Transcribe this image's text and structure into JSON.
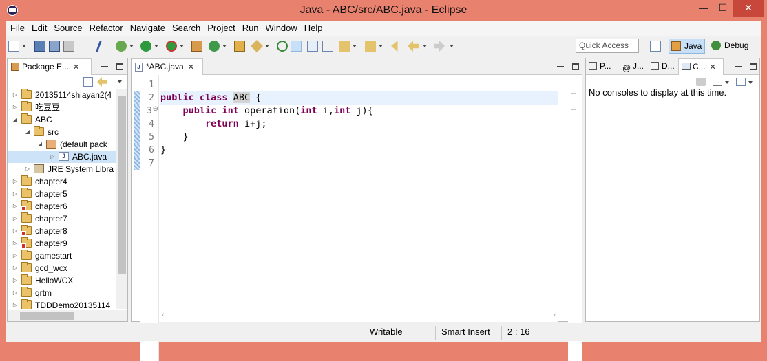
{
  "window": {
    "title": "Java - ABC/src/ABC.java - Eclipse",
    "controls": {
      "minimize": "—",
      "maximize": "☐",
      "close": "✕"
    }
  },
  "menu": [
    "File",
    "Edit",
    "Source",
    "Refactor",
    "Navigate",
    "Search",
    "Project",
    "Run",
    "Window",
    "Help"
  ],
  "toolbar": {
    "quick_access_placeholder": "Quick Access",
    "perspectives": [
      "Java",
      "Debug"
    ],
    "icons": [
      "new-icon",
      "save-icon",
      "save-all-icon",
      "print-icon",
      "toggle-mark-icon",
      "debug-icon",
      "run-icon",
      "external-tools-icon",
      "new-package-icon",
      "new-class-icon",
      "open-type-icon",
      "search-icon",
      "mark-occurrences-icon",
      "block-selection-icon",
      "show-whitespace-icon",
      "next-annotation-icon",
      "prev-annotation-icon",
      "last-edit-icon",
      "back-icon",
      "forward-icon"
    ]
  },
  "package_explorer": {
    "tab_label": "Package E...",
    "tree": [
      {
        "label": "20135114shiayan2(4",
        "depth": 0,
        "expanded": false,
        "kind": "project",
        "error": false
      },
      {
        "label": "吃豆豆",
        "depth": 0,
        "expanded": false,
        "kind": "project",
        "error": false
      },
      {
        "label": "ABC",
        "depth": 0,
        "expanded": true,
        "kind": "project",
        "error": false
      },
      {
        "label": "src",
        "depth": 1,
        "expanded": true,
        "kind": "src",
        "error": false
      },
      {
        "label": "(default pack",
        "depth": 2,
        "expanded": true,
        "kind": "package",
        "error": false
      },
      {
        "label": "ABC.java",
        "depth": 3,
        "expanded": false,
        "kind": "java",
        "error": false,
        "selected": true
      },
      {
        "label": "JRE System Libra",
        "depth": 1,
        "expanded": false,
        "kind": "jre",
        "error": false
      },
      {
        "label": "chapter4",
        "depth": 0,
        "expanded": false,
        "kind": "project",
        "error": false
      },
      {
        "label": "chapter5",
        "depth": 0,
        "expanded": false,
        "kind": "project",
        "error": false
      },
      {
        "label": "chapter6",
        "depth": 0,
        "expanded": false,
        "kind": "project",
        "error": true
      },
      {
        "label": "chapter7",
        "depth": 0,
        "expanded": false,
        "kind": "project",
        "error": false
      },
      {
        "label": "chapter8",
        "depth": 0,
        "expanded": false,
        "kind": "project",
        "error": true
      },
      {
        "label": "chapter9",
        "depth": 0,
        "expanded": false,
        "kind": "project",
        "error": true
      },
      {
        "label": "gamestart",
        "depth": 0,
        "expanded": false,
        "kind": "project",
        "error": false
      },
      {
        "label": "gcd_wcx",
        "depth": 0,
        "expanded": false,
        "kind": "project",
        "error": false
      },
      {
        "label": "HelloWCX",
        "depth": 0,
        "expanded": false,
        "kind": "project",
        "error": false
      },
      {
        "label": "qrtm",
        "depth": 0,
        "expanded": false,
        "kind": "project",
        "error": false
      },
      {
        "label": "TDDDemo20135114",
        "depth": 0,
        "expanded": false,
        "kind": "project",
        "error": false
      }
    ]
  },
  "editor": {
    "tab_label": "*ABC.java",
    "line_numbers": [
      "1",
      "2",
      "3",
      "4",
      "5",
      "6",
      "7"
    ],
    "fold_marker": "⊖"
  },
  "right_pane": {
    "tabs": [
      "P...",
      "J...",
      "D...",
      "C..."
    ],
    "console_message": "No consoles to display at this time."
  },
  "status": {
    "writable": "Writable",
    "insert_mode": "Smart Insert",
    "position": "2 : 16"
  }
}
